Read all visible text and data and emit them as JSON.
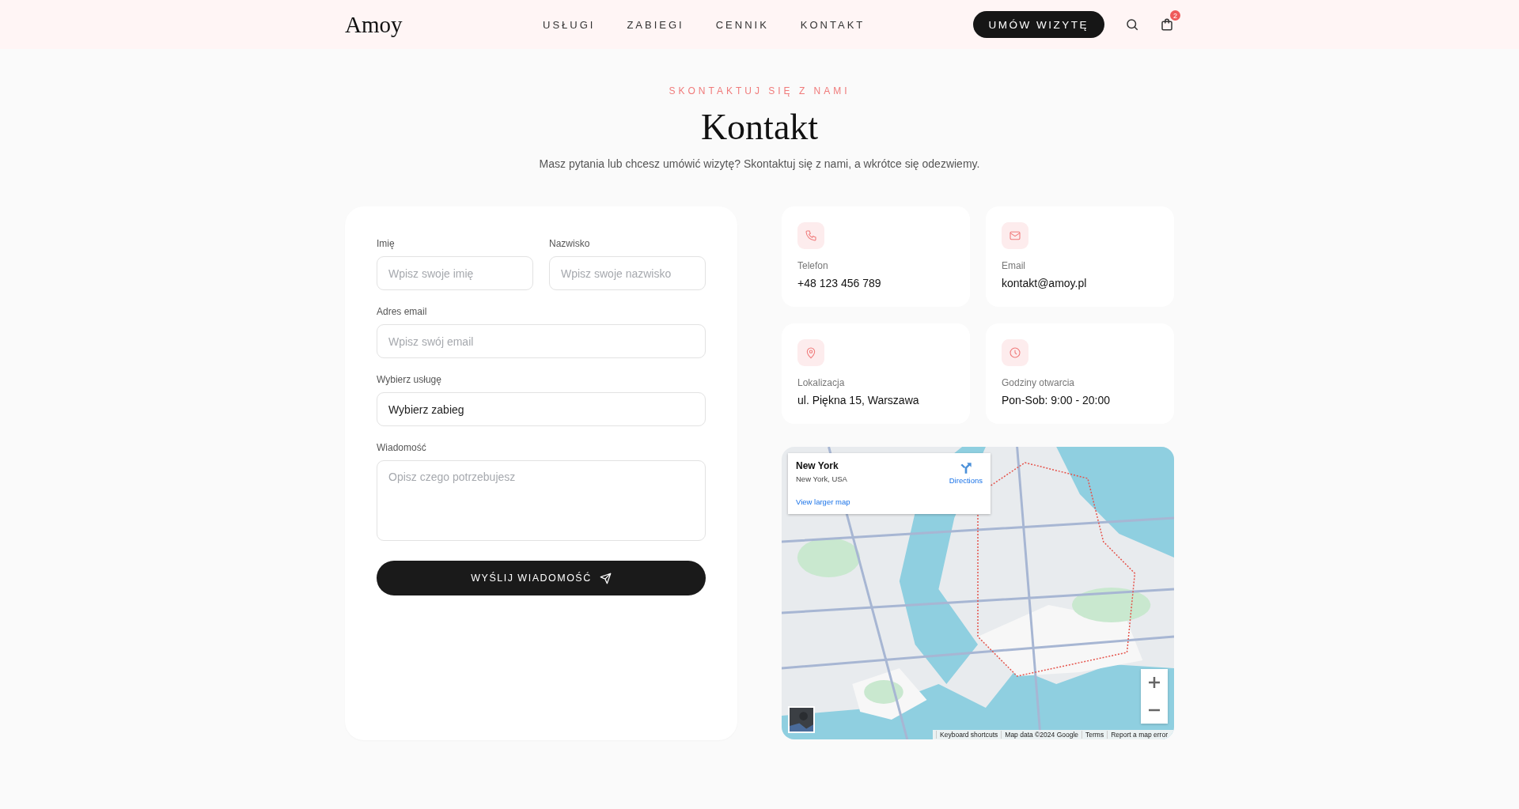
{
  "header": {
    "logo": "Amoy",
    "nav": [
      {
        "label": "USŁUGI"
      },
      {
        "label": "ZABIEGI"
      },
      {
        "label": "CENNIK"
      },
      {
        "label": "KONTAKT"
      }
    ],
    "cta": "UMÓW WIZYTĘ",
    "cart_count": "2"
  },
  "hero": {
    "eyebrow": "SKONTAKTUJ SIĘ Z NAMI",
    "title": "Kontakt",
    "description": "Masz pytania lub chcesz umówić wizytę? Skontaktuj się z nami, a wkrótce się odezwiemy."
  },
  "form": {
    "rows": [
      [
        {
          "kind": "input",
          "label": "Imię",
          "placeholder": "Wpisz swoje imię"
        },
        {
          "kind": "input",
          "label": "Nazwisko",
          "placeholder": "Wpisz swoje nazwisko"
        }
      ],
      [
        {
          "kind": "input",
          "label": "Adres email",
          "placeholder": "Wpisz swój email"
        }
      ],
      [
        {
          "kind": "select",
          "label": "Wybierz usługę",
          "value": "Wybierz zabieg"
        }
      ],
      [
        {
          "kind": "textarea",
          "label": "Wiadomość",
          "placeholder": "Opisz czego potrzebujesz"
        }
      ]
    ],
    "submit": "WYŚLIJ WIADOMOŚĆ"
  },
  "contact_cards": [
    {
      "kind": "phone",
      "label": "Telefon",
      "value": "+48 123 456 789"
    },
    {
      "kind": "email",
      "label": "Email",
      "value": "kontakt@amoy.pl"
    },
    {
      "kind": "location",
      "label": "Lokalizacja",
      "value": "ul. Piękna 15, Warszawa"
    },
    {
      "kind": "hours",
      "label": "Godziny otwarcia",
      "value": "Pon-Sob: 9:00 - 20:00"
    }
  ],
  "map": {
    "kind": "picture",
    "place_card": {
      "title": "New York",
      "subtitle": "New York, USA",
      "directions": "Directions",
      "link": "View larger map"
    },
    "footer": [
      "Keyboard shortcuts",
      "Map data ©2024 Google",
      "Terms",
      "Report a map error"
    ]
  }
}
